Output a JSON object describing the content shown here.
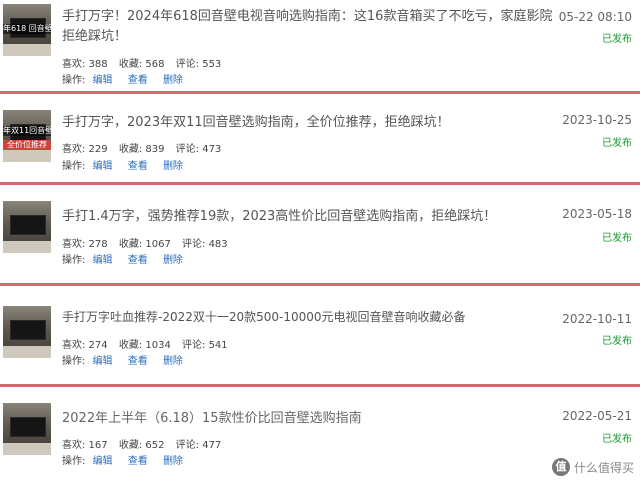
{
  "articles": [
    {
      "title": "手打万字！2024年618回音壁电视音响选购指南：这16款音箱买了不吃亏，家庭影院拒绝踩坑！",
      "thumb_caption": "年618 回音壁 选",
      "thumb_caption2": "",
      "likes_label": "喜欢: 388",
      "favs_label": "收藏: 568",
      "comments_label": "评论: 553",
      "ops_label": "操作:",
      "edit": "编辑",
      "view": "查看",
      "delete": "删除",
      "date": "05-22 08:10",
      "status": "已发布"
    },
    {
      "title": "手打万字，2023年双11回音壁选购指南，全价位推荐，拒绝踩坑！",
      "thumb_caption": "年双11回音壁选",
      "thumb_caption2": "全价位推荐",
      "likes_label": "喜欢: 229",
      "favs_label": "收藏: 839",
      "comments_label": "评论: 473",
      "ops_label": "操作:",
      "edit": "编辑",
      "view": "查看",
      "delete": "删除",
      "date": "2023-10-25",
      "status": "已发布"
    },
    {
      "title": "手打1.4万字，强势推荐19款，2023高性价比回音壁选购指南，拒绝踩坑！",
      "thumb_caption": "",
      "thumb_caption2": "",
      "likes_label": "喜欢: 278",
      "favs_label": "收藏: 1067",
      "comments_label": "评论: 483",
      "ops_label": "操作:",
      "edit": "编辑",
      "view": "查看",
      "delete": "删除",
      "date": "2023-05-18",
      "status": "已发布"
    },
    {
      "title": "手打万字吐血推荐-2022双十一20款500-10000元电视回音壁音响收藏必备",
      "thumb_caption": "",
      "thumb_caption2": "",
      "likes_label": "喜欢: 274",
      "favs_label": "收藏: 1034",
      "comments_label": "评论: 541",
      "ops_label": "操作:",
      "edit": "编辑",
      "view": "查看",
      "delete": "删除",
      "date": "2022-10-11",
      "status": "已发布"
    },
    {
      "title": "2022年上半年（6.18）15款性价比回音壁选购指南",
      "thumb_caption": "",
      "thumb_caption2": "",
      "likes_label": "喜欢: 167",
      "favs_label": "收藏: 652",
      "comments_label": "评论: 477",
      "ops_label": "操作:",
      "edit": "编辑",
      "view": "查看",
      "delete": "删除",
      "date": "2022-05-21",
      "status": "已发布"
    }
  ],
  "watermark": {
    "logo_char": "值",
    "text": "什么值得买"
  },
  "colors": {
    "separator": "#d9676f",
    "link": "#2a6ebf",
    "status_green": "#1a9b32"
  }
}
